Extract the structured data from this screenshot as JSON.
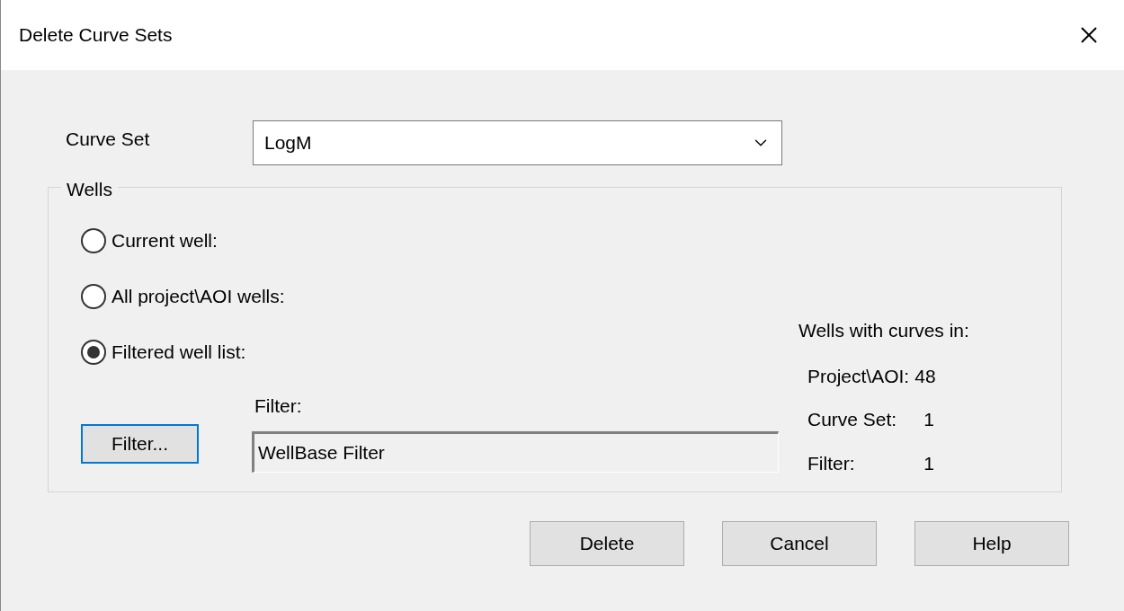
{
  "window": {
    "title": "Delete Curve Sets"
  },
  "curve_set": {
    "label": "Curve Set",
    "value": "LogM"
  },
  "wells": {
    "label": "Wells",
    "options": [
      {
        "label": "Current well:",
        "selected": false
      },
      {
        "label": "All project\\AOI wells:",
        "selected": false
      },
      {
        "label": "Filtered well list:",
        "selected": true
      }
    ],
    "filter_button": "Filter...",
    "filter_label": "Filter:",
    "filter_value": "WellBase Filter",
    "counts_title": "Wells with curves in:",
    "counts": [
      {
        "label": "Project\\AOI:",
        "value": "48"
      },
      {
        "label": "Curve Set:",
        "value": "1"
      },
      {
        "label": "Filter:",
        "value": "1"
      }
    ]
  },
  "buttons": [
    {
      "label": "Delete"
    },
    {
      "label": "Cancel"
    },
    {
      "label": "Help"
    }
  ]
}
